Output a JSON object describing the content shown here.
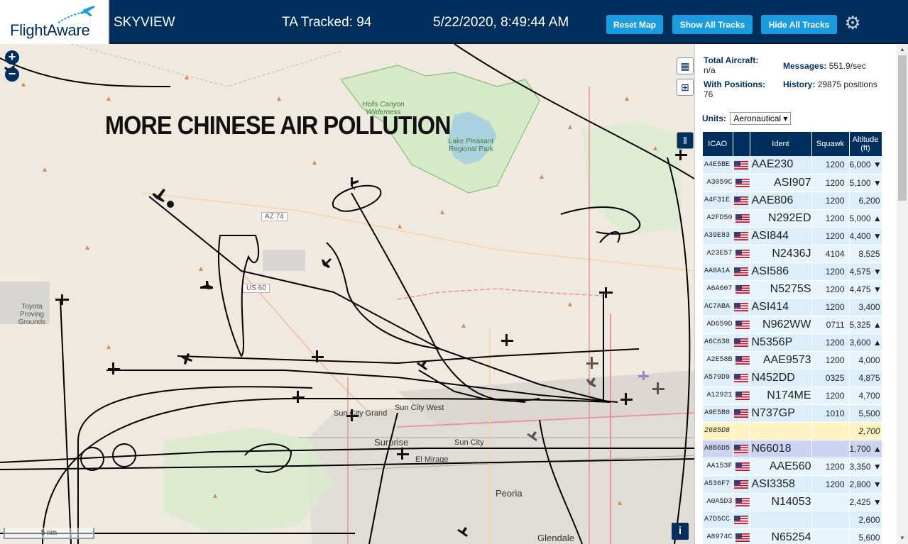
{
  "header": {
    "logo_text": "FlightAware",
    "app_name": "SKYVIEW",
    "tracked": "TA Tracked: 94",
    "datetime": "5/22/2020, 8:49:44 AM",
    "buttons": {
      "reset": "Reset Map",
      "show_all": "Show All Tracks",
      "hide_all": "Hide All Tracks"
    },
    "settings_icon": "gear-icon"
  },
  "map": {
    "overlay_text": "MORE CHINESE AIR POLLUTION",
    "zoom_in": "+",
    "zoom_out": "−",
    "scale": "5 nm",
    "labels": {
      "hells_canyon": "Hells Canyon Wilderness",
      "lake_pleasant": "Lake Pleasant Regional Park",
      "toyota": "Toyota Proving Grounds",
      "az74": "AZ 74",
      "us60": "US 60",
      "surprise": "Surprise",
      "sun_city": "Sun City",
      "sun_city_west": "Sun City West",
      "sun_city_grand": "Sun City Grand",
      "el_mirage": "El Mirage",
      "peoria": "Peoria",
      "glendale": "Glendale"
    },
    "info": "i",
    "colors": {
      "water": "#aad3df",
      "park": "#cfe7c5",
      "urban": "#dddddd",
      "road": "#e892a2",
      "track": "#000000"
    }
  },
  "sidebar": {
    "total_aircraft_label": "Total Aircraft:",
    "total_aircraft_value": "n/a",
    "messages_label": "Messages:",
    "messages_value": "551.9/sec",
    "with_positions_label": "With Positions:",
    "with_positions_value": "76",
    "history_label": "History:",
    "history_value": "29875 positions",
    "units_label": "Units:",
    "units_value": "Aeronautical ▾",
    "columns": [
      "ICAO",
      "Ident",
      "Squawk",
      "Altitude (ft)"
    ]
  },
  "aircraft": [
    {
      "icao": "A4E5BE",
      "ident": "AAE230",
      "squawk": "1200",
      "alt": "6,000 ▼"
    },
    {
      "icao": "A3059C",
      "ident": "ASI907",
      "squawk": "1200",
      "alt": "5,100 ▼"
    },
    {
      "icao": "A4F31E",
      "ident": "AAE806",
      "squawk": "1200",
      "alt": "6,200"
    },
    {
      "icao": "A2FD50",
      "ident": "N292ED",
      "squawk": "1200",
      "alt": "5,000 ▲"
    },
    {
      "icao": "A39E83",
      "ident": "ASI844",
      "squawk": "1200",
      "alt": "4,400 ▼"
    },
    {
      "icao": "A23E57",
      "ident": "N2436J",
      "squawk": "4104",
      "alt": "8,525"
    },
    {
      "icao": "AA0A1A",
      "ident": "ASI586",
      "squawk": "1200",
      "alt": "4,575 ▼"
    },
    {
      "icao": "A6A607",
      "ident": "N5275S",
      "squawk": "1200",
      "alt": "4,475 ▼"
    },
    {
      "icao": "AC7ABA",
      "ident": "ASI414",
      "squawk": "1200",
      "alt": "3,400"
    },
    {
      "icao": "AD659D",
      "ident": "N962WW",
      "squawk": "0711",
      "alt": "5,325 ▲"
    },
    {
      "icao": "A6C638",
      "ident": "N5356P",
      "squawk": "1200",
      "alt": "3,600 ▲"
    },
    {
      "icao": "A2E58B",
      "ident": "AAE9573",
      "squawk": "1200",
      "alt": "4,000"
    },
    {
      "icao": "A579D9",
      "ident": "N452DD",
      "squawk": "0325",
      "alt": "4,875"
    },
    {
      "icao": "A12921",
      "ident": "N174ME",
      "squawk": "1200",
      "alt": "4,700"
    },
    {
      "icao": "A9E5B0",
      "ident": "N737GP",
      "squawk": "1010",
      "alt": "5,500"
    },
    {
      "icao": "2685D8",
      "ident": "",
      "squawk": "",
      "alt": "2,700",
      "noflag": true,
      "style": "no"
    },
    {
      "icao": "A8B6D5",
      "ident": "N66018",
      "squawk": "",
      "alt": "1,700 ▲",
      "style": "sel"
    },
    {
      "icao": "AA153F",
      "ident": "AAE560",
      "squawk": "1200",
      "alt": "3,350 ▼"
    },
    {
      "icao": "A536F7",
      "ident": "ASI3358",
      "squawk": "1200",
      "alt": "2,800 ▼"
    },
    {
      "icao": "A0A5D3",
      "ident": "N14053",
      "squawk": "",
      "alt": "2,425 ▼"
    },
    {
      "icao": "A7D5CC",
      "ident": "",
      "squawk": "",
      "alt": "2,600"
    },
    {
      "icao": "A8974C",
      "ident": "N65254",
      "squawk": "",
      "alt": "5,600"
    }
  ]
}
